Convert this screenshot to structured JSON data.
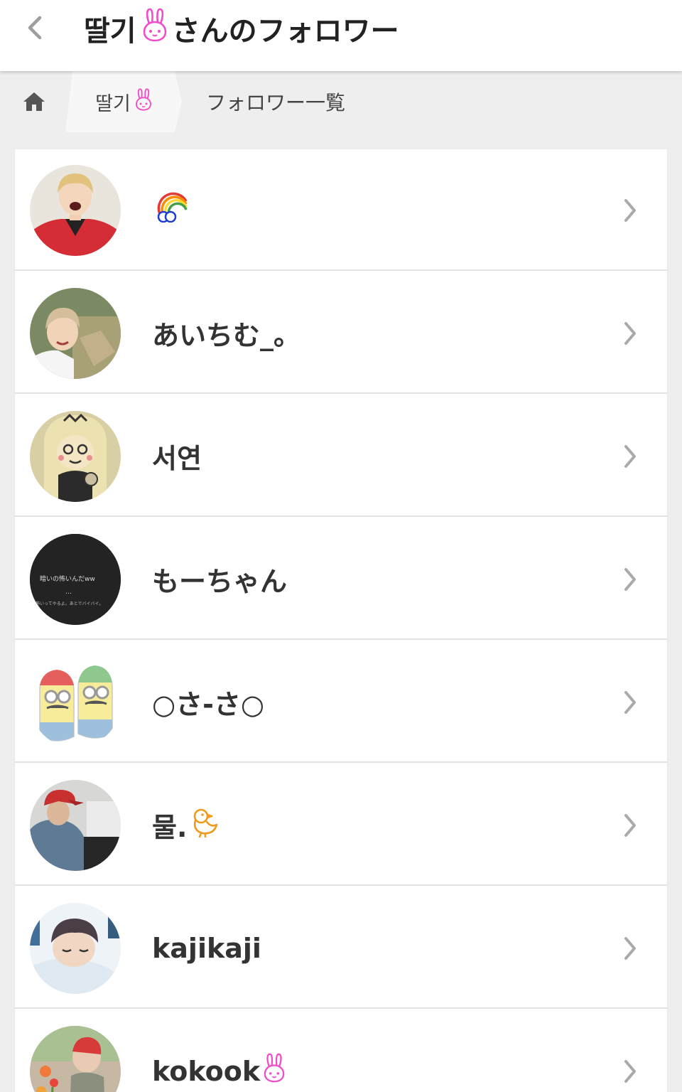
{
  "header": {
    "back_icon": "chevron-left-icon",
    "title_name": "딸기",
    "title_suffix": "さんのフォロワー",
    "bunny_icon": "rabbit-face-icon"
  },
  "breadcrumb": {
    "home_icon": "home-icon",
    "user": "딸기",
    "current": "フォロワー一覧"
  },
  "followers": [
    {
      "name": "",
      "emoji": "rainbow-icon",
      "avatar": "red-jacket-photo"
    },
    {
      "name": "あいちむ_。",
      "avatar": "smiling-photo"
    },
    {
      "name": "서연",
      "avatar": "cartoon-girl"
    },
    {
      "name": "もーちゃん",
      "avatar": "black-text-image",
      "avatar_text_1": "暗いの怖いんだww",
      "avatar_text_2": "…",
      "avatar_text_3": "怖いってやるよ。あとでバイバイ。"
    },
    {
      "name": "○さ-さ○",
      "avatar": "minion-cartoon"
    },
    {
      "name": "물.",
      "emoji": "chick-icon",
      "avatar": "hoodie-photo"
    },
    {
      "name": "kajikaji",
      "avatar": "sleeping-photo"
    },
    {
      "name": "kokook",
      "emoji": "rabbit-face-icon",
      "avatar": "flowers-photo"
    }
  ],
  "colors": {
    "header_bg": "#ffffff",
    "page_bg": "#eeeeee",
    "bunny_pink": "#f04cc8",
    "chevron": "#aaaaaa"
  }
}
